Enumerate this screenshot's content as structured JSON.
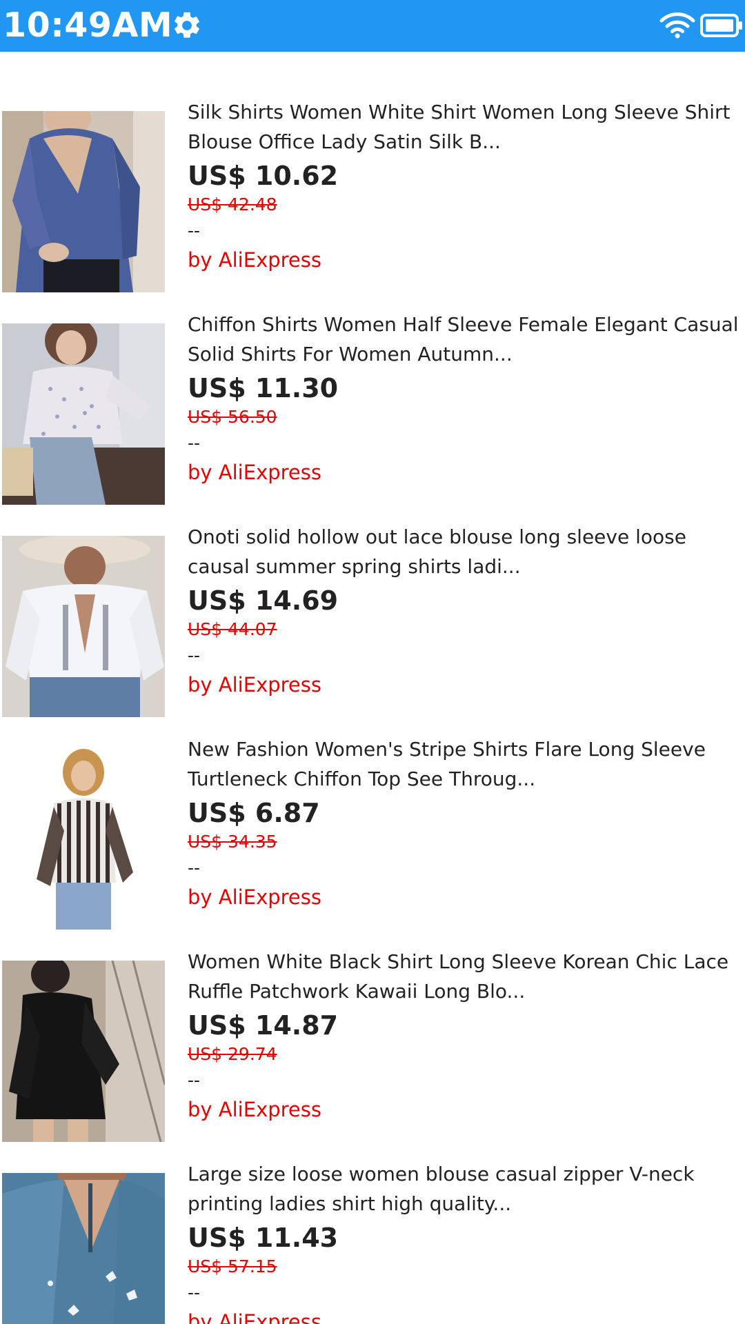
{
  "status_bar": {
    "time": "10:49AM",
    "color": "#2196F3",
    "icons": [
      "gear-icon",
      "wifi-icon",
      "battery-icon"
    ]
  },
  "products": [
    {
      "title": "Silk Shirts Women White Shirt Women Long Sleeve Shirt Blouse Office Lady Satin Silk B...",
      "price": "US$ 10.62",
      "original_price": "US$ 42.48",
      "rating": "--",
      "seller": "by AliExpress"
    },
    {
      "title": "Chiffon Shirts Women Half Sleeve Female Elegant Casual Solid Shirts For Women Autumn...",
      "price": "US$ 11.30",
      "original_price": "US$ 56.50",
      "rating": "--",
      "seller": "by AliExpress"
    },
    {
      "title": "Onoti solid hollow out lace blouse long sleeve loose causal summer spring shirts ladi...",
      "price": "US$ 14.69",
      "original_price": "US$ 44.07",
      "rating": "--",
      "seller": "by AliExpress"
    },
    {
      "title": "New Fashion Women's Stripe Shirts Flare Long Sleeve Turtleneck Chiffon Top See Throug...",
      "price": "US$ 6.87",
      "original_price": "US$ 34.35",
      "rating": "--",
      "seller": "by AliExpress"
    },
    {
      "title": "Women White Black Shirt Long Sleeve Korean Chic Lace Ruffle Patchwork Kawaii Long Blo...",
      "price": "US$ 14.87",
      "original_price": "US$ 29.74",
      "rating": "--",
      "seller": "by AliExpress"
    },
    {
      "title": "Large size loose women blouse casual zipper V-neck printing ladies shirt high quality...",
      "price": "US$ 11.43",
      "original_price": "US$ 57.15",
      "rating": "--",
      "seller": "by AliExpress"
    }
  ]
}
